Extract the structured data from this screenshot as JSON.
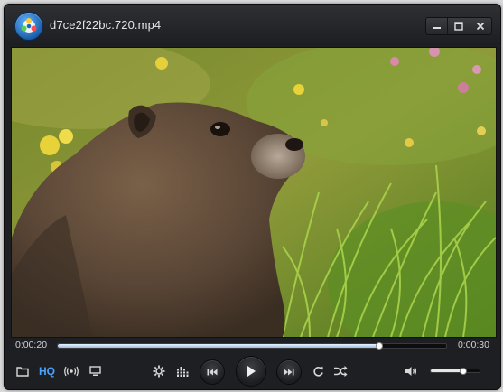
{
  "window": {
    "title": "d7ce2f22bc.720.mp4"
  },
  "playback": {
    "current_time": "0:00:20",
    "duration": "0:00:30",
    "progress_fraction": 0.826,
    "volume_fraction": 0.65
  },
  "toolbar": {
    "hq_label": "HQ"
  },
  "icons": {
    "app": "media-player-logo-icon",
    "minimize": "minimize-icon",
    "maximize": "maximize-icon",
    "close": "close-icon",
    "open": "folder-icon",
    "stream": "broadcast-icon",
    "screen": "monitor-icon",
    "settings": "gear-icon",
    "equalizer": "equalizer-icon",
    "prev": "previous-icon",
    "play": "play-icon",
    "next": "next-icon",
    "repeat": "repeat-icon",
    "shuffle": "shuffle-icon",
    "volume": "speaker-icon"
  },
  "colors": {
    "accent": "#4aa2ff",
    "window_bg": "#1e1f22"
  }
}
